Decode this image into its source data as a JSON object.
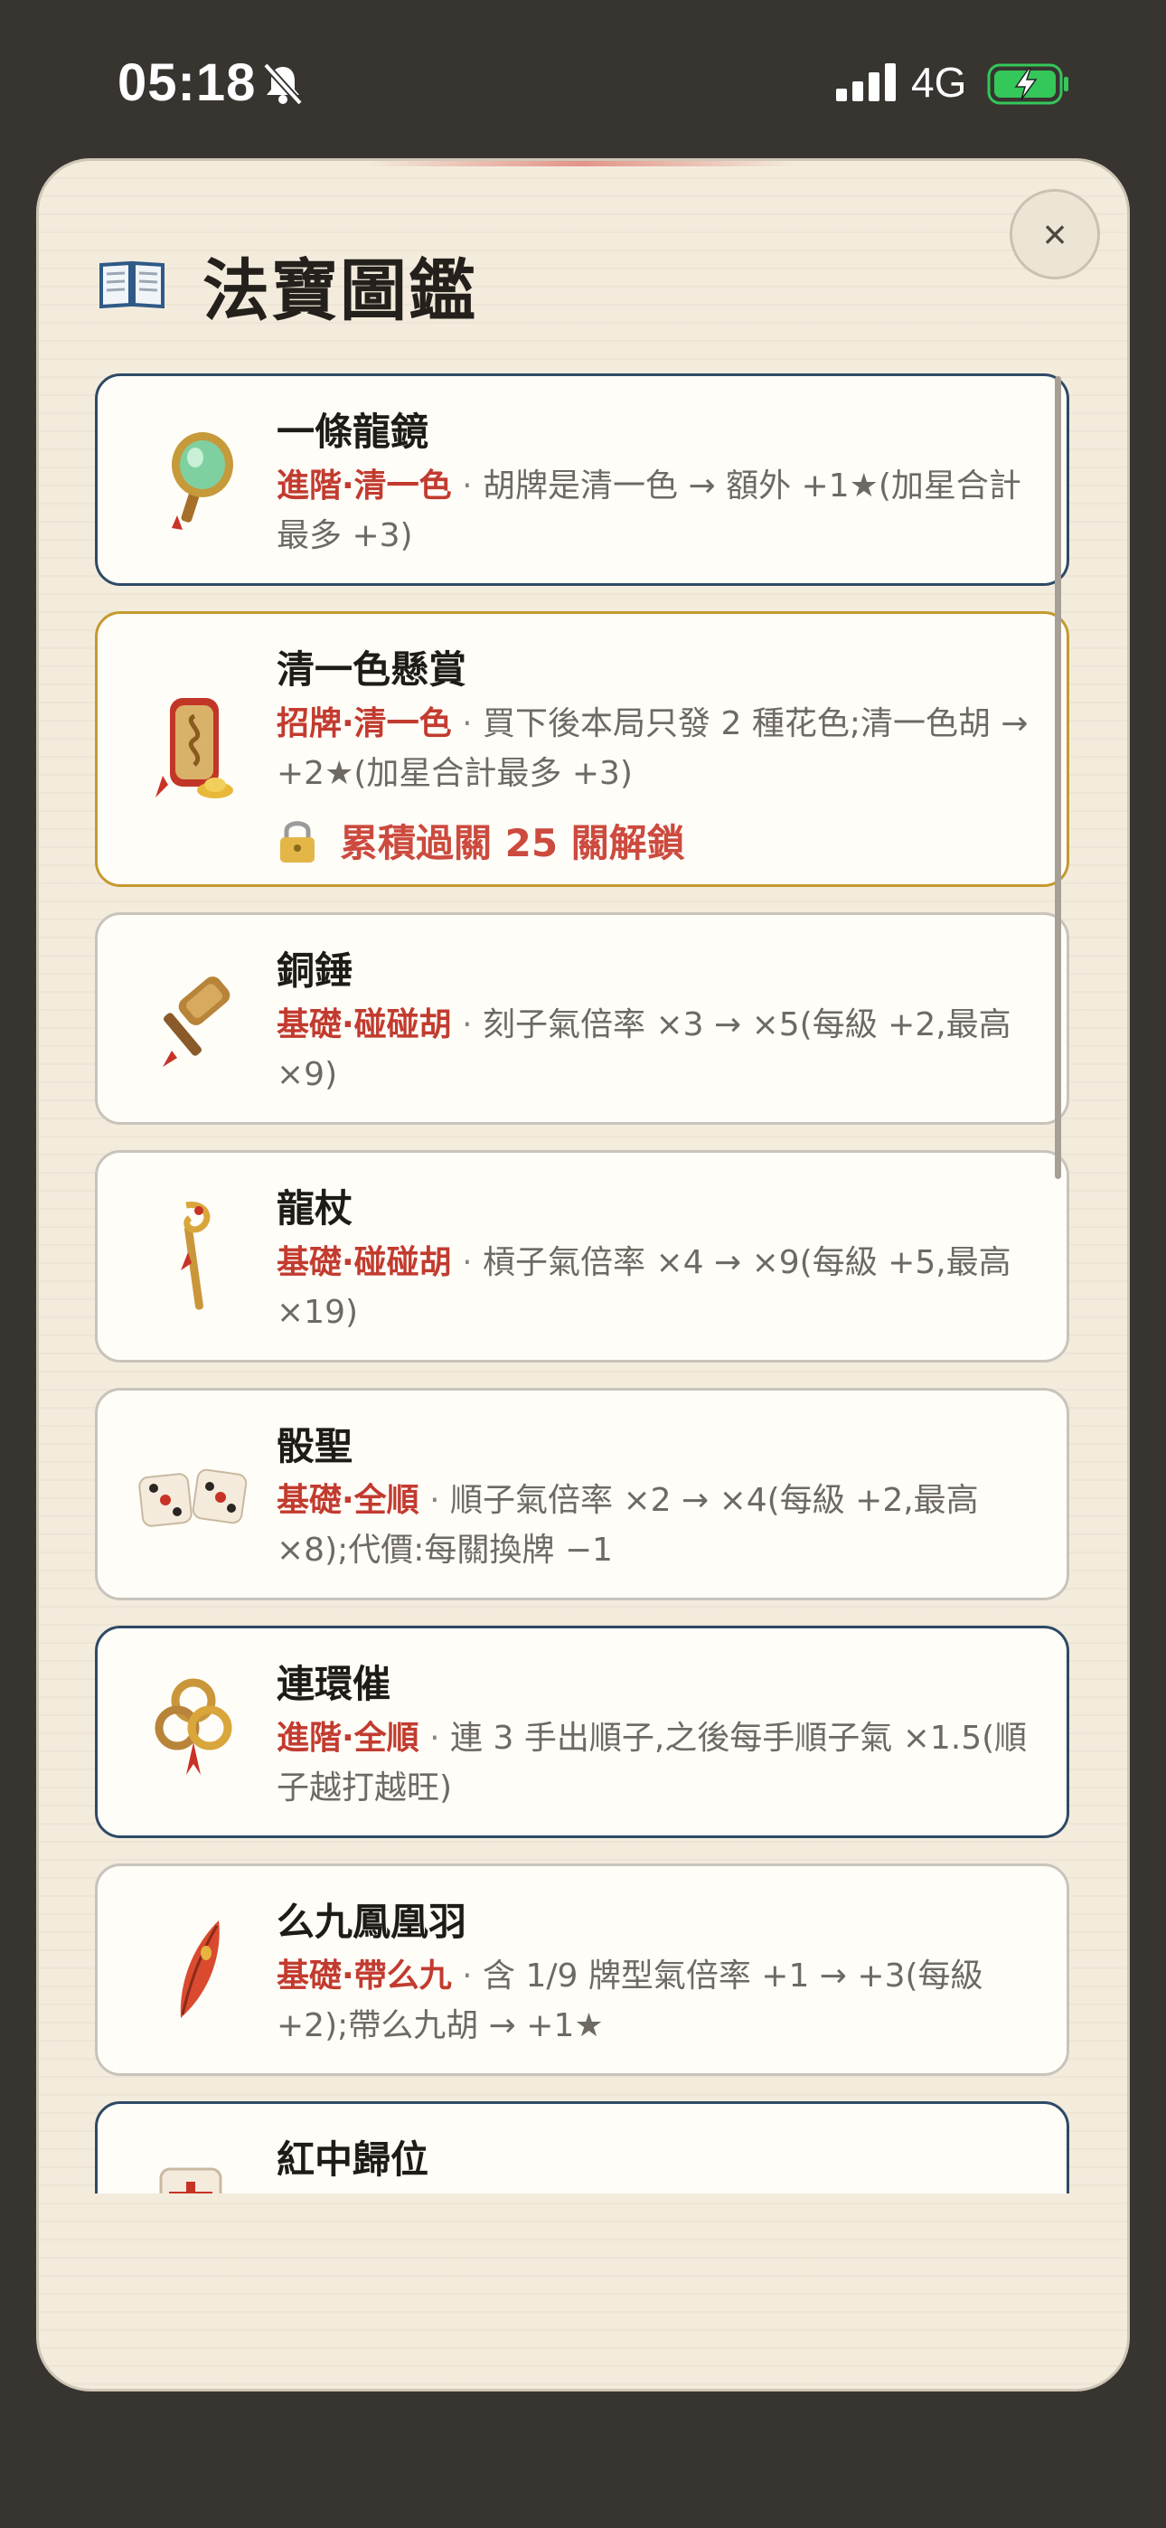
{
  "status_bar": {
    "time": "05:18",
    "network": "4G",
    "icons": [
      "bell-muted-icon",
      "signal-icon",
      "battery-charging-icon"
    ],
    "battery_color": "#34c759"
  },
  "modal": {
    "title": "法寶圖鑑",
    "close_label": "×",
    "title_icon": "book-icon"
  },
  "colors": {
    "tag": "#c23b2f",
    "advanced_border": "#2e4a66",
    "locked_border": "#c59a2e",
    "basic_border": "#c8c3bb"
  },
  "items": [
    {
      "name": "一條龍鏡",
      "tag": "進階·清一色",
      "separator": " · ",
      "desc": "胡牌是清一色 → 額外 +1★(加星合計最多 +3)",
      "icon": "dragon-mirror-icon",
      "tier": "advanced"
    },
    {
      "name": "清一色懸賞",
      "tag": "招牌·清一色",
      "separator": " · ",
      "desc": "買下後本局只發 2 種花色;清一色胡 → +2★(加星合計最多 +3)",
      "icon": "bounty-plaque-icon",
      "tier": "locked",
      "lock_text": "累積過關 25 關解鎖"
    },
    {
      "name": "銅錘",
      "tag": "基礎·碰碰胡",
      "separator": " · ",
      "desc": "刻子氣倍率 ×3 → ×5(每級 +2,最高 ×9)",
      "icon": "bronze-hammer-icon",
      "tier": "basic"
    },
    {
      "name": "龍杖",
      "tag": "基礎·碰碰胡",
      "separator": " · ",
      "desc": "槓子氣倍率 ×4 → ×9(每級 +5,最高 ×19)",
      "icon": "dragon-staff-icon",
      "tier": "basic"
    },
    {
      "name": "骰聖",
      "tag": "基礎·全順",
      "separator": " · ",
      "desc": "順子氣倍率 ×2 → ×4(每級 +2,最高 ×8);代價:每關換牌 −1",
      "icon": "dice-icon",
      "tier": "basic"
    },
    {
      "name": "連環催",
      "tag": "進階·全順",
      "separator": " · ",
      "desc": "連 3 手出順子,之後每手順子氣 ×1.5(順子越打越旺)",
      "icon": "chain-coins-icon",
      "tier": "advanced"
    },
    {
      "name": "么九鳳凰羽",
      "tag": "基礎·帶么九",
      "separator": " · ",
      "desc": "含 1/9 牌型氣倍率 +1 → +3(每級 +2);帶么九胡 → +1★",
      "icon": "phoenix-feather-icon",
      "tier": "basic"
    },
    {
      "name": "紅中歸位",
      "tag": "",
      "separator": "",
      "desc": "",
      "icon": "red-dragon-tile-icon",
      "tier": "advanced"
    }
  ]
}
